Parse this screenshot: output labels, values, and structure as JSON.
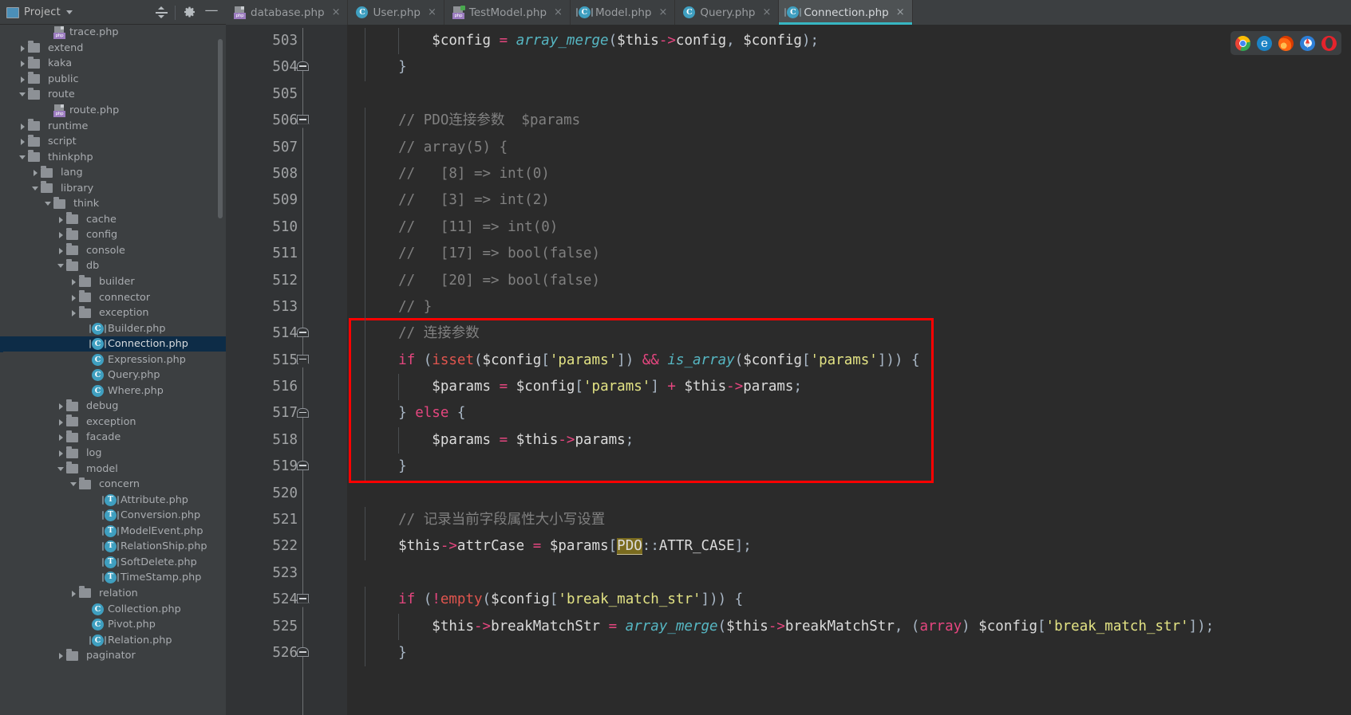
{
  "project_panel": {
    "title": "Project",
    "icon": "project-icon",
    "dropdown_icon": "chevron-down-icon",
    "tools": [
      {
        "name": "collapse-all-icon",
        "label": ""
      },
      {
        "name": "settings-gear-icon",
        "label": ""
      },
      {
        "name": "hide-panel-icon",
        "label": "—"
      }
    ],
    "tree": [
      {
        "label": "trace.php",
        "indent": 3,
        "arrow": "none",
        "icon": "php-file-icon",
        "selected": false
      },
      {
        "label": "extend",
        "indent": 1,
        "arrow": "right",
        "icon": "folder-icon",
        "selected": false
      },
      {
        "label": "kaka",
        "indent": 1,
        "arrow": "right",
        "icon": "folder-icon",
        "selected": false
      },
      {
        "label": "public",
        "indent": 1,
        "arrow": "right",
        "icon": "folder-icon",
        "selected": false
      },
      {
        "label": "route",
        "indent": 1,
        "arrow": "down",
        "icon": "folder-icon",
        "selected": false
      },
      {
        "label": "route.php",
        "indent": 3,
        "arrow": "none",
        "icon": "php-file-icon",
        "selected": false
      },
      {
        "label": "runtime",
        "indent": 1,
        "arrow": "right",
        "icon": "folder-icon",
        "selected": false
      },
      {
        "label": "script",
        "indent": 1,
        "arrow": "right",
        "icon": "folder-icon",
        "selected": false
      },
      {
        "label": "thinkphp",
        "indent": 1,
        "arrow": "down",
        "icon": "folder-icon",
        "selected": false
      },
      {
        "label": "lang",
        "indent": 2,
        "arrow": "right",
        "icon": "folder-icon",
        "selected": false
      },
      {
        "label": "library",
        "indent": 2,
        "arrow": "down",
        "icon": "folder-icon",
        "selected": false
      },
      {
        "label": "think",
        "indent": 3,
        "arrow": "down",
        "icon": "folder-icon",
        "selected": false
      },
      {
        "label": "cache",
        "indent": 4,
        "arrow": "right",
        "icon": "folder-icon",
        "selected": false
      },
      {
        "label": "config",
        "indent": 4,
        "arrow": "right",
        "icon": "folder-icon",
        "selected": false
      },
      {
        "label": "console",
        "indent": 4,
        "arrow": "right",
        "icon": "folder-icon",
        "selected": false
      },
      {
        "label": "db",
        "indent": 4,
        "arrow": "down",
        "icon": "folder-icon",
        "selected": false
      },
      {
        "label": "builder",
        "indent": 5,
        "arrow": "right",
        "icon": "folder-icon",
        "selected": false
      },
      {
        "label": "connector",
        "indent": 5,
        "arrow": "right",
        "icon": "folder-icon",
        "selected": false
      },
      {
        "label": "exception",
        "indent": 5,
        "arrow": "right",
        "icon": "folder-icon",
        "selected": false
      },
      {
        "label": "Builder.php",
        "indent": 6,
        "arrow": "none",
        "icon": "abstract-class-icon",
        "selected": false
      },
      {
        "label": "Connection.php",
        "indent": 6,
        "arrow": "none",
        "icon": "abstract-class-icon",
        "selected": true
      },
      {
        "label": "Expression.php",
        "indent": 6,
        "arrow": "none",
        "icon": "class-icon",
        "selected": false
      },
      {
        "label": "Query.php",
        "indent": 6,
        "arrow": "none",
        "icon": "class-icon",
        "selected": false
      },
      {
        "label": "Where.php",
        "indent": 6,
        "arrow": "none",
        "icon": "class-icon",
        "selected": false
      },
      {
        "label": "debug",
        "indent": 4,
        "arrow": "right",
        "icon": "folder-icon",
        "selected": false
      },
      {
        "label": "exception",
        "indent": 4,
        "arrow": "right",
        "icon": "folder-icon",
        "selected": false
      },
      {
        "label": "facade",
        "indent": 4,
        "arrow": "right",
        "icon": "folder-icon",
        "selected": false
      },
      {
        "label": "log",
        "indent": 4,
        "arrow": "right",
        "icon": "folder-icon",
        "selected": false
      },
      {
        "label": "model",
        "indent": 4,
        "arrow": "down",
        "icon": "folder-icon",
        "selected": false
      },
      {
        "label": "concern",
        "indent": 5,
        "arrow": "down",
        "icon": "folder-icon",
        "selected": false
      },
      {
        "label": "Attribute.php",
        "indent": 7,
        "arrow": "none",
        "icon": "trait-icon",
        "selected": false
      },
      {
        "label": "Conversion.php",
        "indent": 7,
        "arrow": "none",
        "icon": "trait-icon",
        "selected": false
      },
      {
        "label": "ModelEvent.php",
        "indent": 7,
        "arrow": "none",
        "icon": "trait-icon",
        "selected": false
      },
      {
        "label": "RelationShip.php",
        "indent": 7,
        "arrow": "none",
        "icon": "trait-icon",
        "selected": false
      },
      {
        "label": "SoftDelete.php",
        "indent": 7,
        "arrow": "none",
        "icon": "trait-icon",
        "selected": false
      },
      {
        "label": "TimeStamp.php",
        "indent": 7,
        "arrow": "none",
        "icon": "trait-icon",
        "selected": false
      },
      {
        "label": "relation",
        "indent": 5,
        "arrow": "right",
        "icon": "folder-icon",
        "selected": false
      },
      {
        "label": "Collection.php",
        "indent": 6,
        "arrow": "none",
        "icon": "class-icon",
        "selected": false
      },
      {
        "label": "Pivot.php",
        "indent": 6,
        "arrow": "none",
        "icon": "class-icon",
        "selected": false
      },
      {
        "label": "Relation.php",
        "indent": 6,
        "arrow": "none",
        "icon": "abstract-class-icon",
        "selected": false
      },
      {
        "label": "paginator",
        "indent": 4,
        "arrow": "right",
        "icon": "folder-icon",
        "selected": false
      }
    ]
  },
  "tabs": [
    {
      "label": "database.php",
      "icon": "php-file-icon",
      "active": false,
      "close": "×"
    },
    {
      "label": "User.php",
      "icon": "class-icon",
      "active": false,
      "close": "×"
    },
    {
      "label": "TestModel.php",
      "icon": "php-file-icon-green",
      "active": false,
      "close": "×"
    },
    {
      "label": "Model.php",
      "icon": "abstract-class-icon",
      "active": false,
      "close": "×"
    },
    {
      "label": "Query.php",
      "icon": "class-icon",
      "active": false,
      "close": "×"
    },
    {
      "label": "Connection.php",
      "icon": "abstract-class-icon",
      "active": true,
      "close": "×"
    }
  ],
  "browser_bar": {
    "icons": [
      {
        "name": "chrome-icon",
        "label": ""
      },
      {
        "name": "edge-icon",
        "label": "e"
      },
      {
        "name": "firefox-icon",
        "label": ""
      },
      {
        "name": "safari-icon",
        "label": ""
      },
      {
        "name": "opera-icon",
        "label": "O"
      }
    ]
  },
  "editor": {
    "file": "Connection.php",
    "first_line": 503,
    "line_numbers": [
      503,
      504,
      505,
      506,
      507,
      508,
      509,
      510,
      511,
      512,
      513,
      514,
      515,
      516,
      517,
      518,
      519,
      520,
      521,
      522,
      523,
      524,
      525,
      526
    ],
    "folds": [
      {
        "line": 504,
        "type": "start"
      },
      {
        "line": 506,
        "type": "end"
      },
      {
        "line": 514,
        "type": "start"
      },
      {
        "line": 515,
        "type": "end"
      },
      {
        "line": 517,
        "type": "start"
      },
      {
        "line": 519,
        "type": "start"
      },
      {
        "line": 524,
        "type": "end"
      },
      {
        "line": 526,
        "type": "start"
      }
    ],
    "highlight_box": {
      "color": "#ff0000",
      "from_line": 514,
      "to_line": 519
    },
    "lines": [
      {
        "n": 503,
        "text": "        $config = array_merge($this->config, $config);"
      },
      {
        "n": 504,
        "text": "    }"
      },
      {
        "n": 505,
        "text": ""
      },
      {
        "n": 506,
        "text": "    // PDO连接参数  $params"
      },
      {
        "n": 507,
        "text": "    // array(5) {"
      },
      {
        "n": 508,
        "text": "    //   [8] => int(0)"
      },
      {
        "n": 509,
        "text": "    //   [3] => int(2)"
      },
      {
        "n": 510,
        "text": "    //   [11] => int(0)"
      },
      {
        "n": 511,
        "text": "    //   [17] => bool(false)"
      },
      {
        "n": 512,
        "text": "    //   [20] => bool(false)"
      },
      {
        "n": 513,
        "text": "    // }"
      },
      {
        "n": 514,
        "text": "    // 连接参数"
      },
      {
        "n": 515,
        "text": "    if (isset($config['params']) && is_array($config['params'])) {"
      },
      {
        "n": 516,
        "text": "        $params = $config['params'] + $this->params;"
      },
      {
        "n": 517,
        "text": "    } else {"
      },
      {
        "n": 518,
        "text": "        $params = $this->params;"
      },
      {
        "n": 519,
        "text": "    }"
      },
      {
        "n": 520,
        "text": ""
      },
      {
        "n": 521,
        "text": "    // 记录当前字段属性大小写设置"
      },
      {
        "n": 522,
        "text": "    $this->attrCase = $params[PDO::ATTR_CASE];"
      },
      {
        "n": 523,
        "text": ""
      },
      {
        "n": 524,
        "text": "    if (!empty($config['break_match_str'])) {"
      },
      {
        "n": 525,
        "text": "        $this->breakMatchStr = array_merge($this->breakMatchStr, (array) $config['break_match_str']);"
      },
      {
        "n": 526,
        "text": "    }"
      }
    ]
  },
  "colors": {
    "background": "#2b2b2b",
    "gutter": "#313335",
    "panel": "#3c3f41",
    "selection": "#0d2c47",
    "tab_accent": "#37b7c3",
    "comment": "#808080",
    "keyword": "#e5467f",
    "function": "#56b6c2",
    "string": "#e3e384",
    "builtin": "#e0554e",
    "highlight_box": "#ff0000",
    "identifier_highlight": "#7a6b1f"
  }
}
